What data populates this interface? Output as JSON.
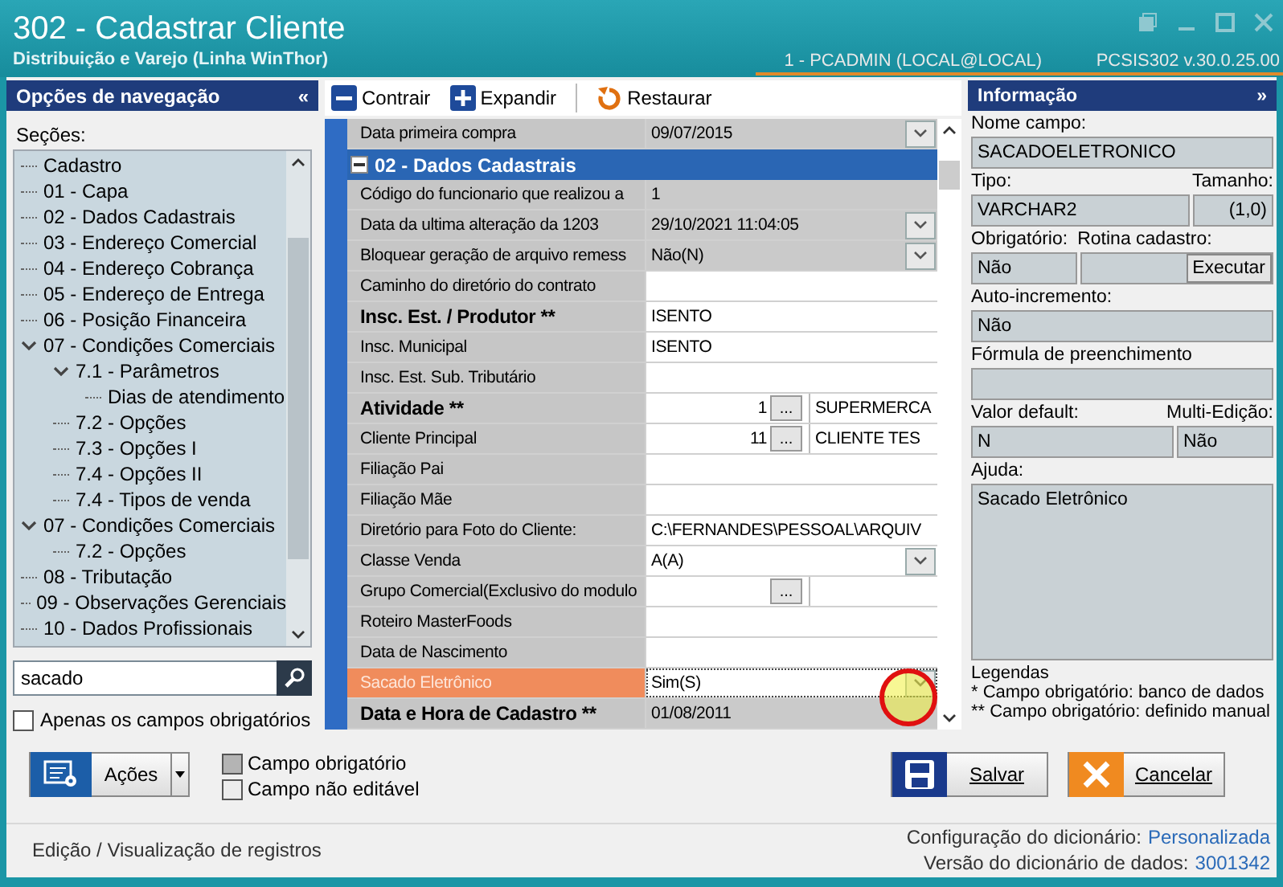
{
  "window": {
    "title": "302 - Cadastrar Cliente",
    "subtitle": "Distribuição e Varejo (Linha WinThor)",
    "user": "1 - PCADMIN (LOCAL@LOCAL)",
    "version": "PCSIS302  v.30.0.25.00"
  },
  "navigation": {
    "title": "Opções de navegação",
    "collapse": "«",
    "sections_label": "Seções:",
    "tree": [
      {
        "label": "Cadastro"
      },
      {
        "label": "01 - Capa"
      },
      {
        "label": "02 - Dados Cadastrais"
      },
      {
        "label": "03 - Endereço Comercial"
      },
      {
        "label": "04 - Endereço Cobrança"
      },
      {
        "label": "05 - Endereço de Entrega"
      },
      {
        "label": "06 - Posição Financeira"
      },
      {
        "label": "07 - Condições Comerciais",
        "expanded": true,
        "children": [
          {
            "label": "7.1 - Parâmetros",
            "expanded": true,
            "children": [
              {
                "label": "Dias de atendimento"
              }
            ]
          },
          {
            "label": "7.2 - Opções"
          },
          {
            "label": "7.3 - Opções I"
          },
          {
            "label": "7.4 - Opções II"
          },
          {
            "label": "7.4 - Tipos de venda"
          }
        ]
      },
      {
        "label": "07 - Condições Comerciais",
        "expanded": true,
        "children": [
          {
            "label": "7.2 - Opções"
          }
        ]
      },
      {
        "label": "08 - Tributação"
      },
      {
        "label": "09 - Observações Gerenciais"
      },
      {
        "label": "10 - Dados Profissionais"
      }
    ],
    "search": {
      "value": "sacado"
    },
    "only_required": {
      "label": "Apenas os campos obrigatórios",
      "checked": false
    }
  },
  "toolbar": [
    {
      "kind": "collapse",
      "label": "Contrair"
    },
    {
      "kind": "expand",
      "label": "Expandir"
    },
    {
      "kind": "restore",
      "label": "Restaurar"
    }
  ],
  "grid": {
    "rows": [
      {
        "kind": "dropdown",
        "label": "Data primeira compra",
        "bold": false,
        "value": "09/07/2015",
        "editable": false,
        "selected": false
      },
      {
        "kind": "section",
        "label": "02 - Dados Cadastrais",
        "expanded": true
      },
      {
        "kind": "text",
        "label": "Código do funcionario que realizou a",
        "bold": false,
        "value": "1",
        "editable": false,
        "selected": false
      },
      {
        "kind": "dropdown",
        "label": "Data da ultima alteração da 1203",
        "bold": false,
        "value": "29/10/2021 11:04:05",
        "editable": false,
        "selected": false
      },
      {
        "kind": "dropdown",
        "label": "Bloquear geração de arquivo remess",
        "bold": false,
        "value": "Não(N)",
        "editable": false,
        "selected": false
      },
      {
        "kind": "text",
        "label": "Caminho do diretório do contrato",
        "bold": false,
        "editable": true,
        "selected": false
      },
      {
        "kind": "text",
        "label": "Insc. Est. / Produtor **",
        "bold": true,
        "value": "ISENTO",
        "editable": true,
        "selected": false
      },
      {
        "kind": "text",
        "label": "Insc. Municipal",
        "bold": false,
        "value": "ISENTO",
        "editable": true,
        "selected": false
      },
      {
        "kind": "text",
        "label": "Insc. Est. Sub. Tributário",
        "bold": false,
        "editable": true,
        "selected": false
      },
      {
        "kind": "lookup",
        "label": "Atividade **",
        "bold": true,
        "code": "1",
        "button": "...",
        "description": "SUPERMERCA",
        "editable": true,
        "selected": false
      },
      {
        "kind": "lookup",
        "label": "Cliente Principal",
        "bold": false,
        "code": "11",
        "button": "...",
        "description": "CLIENTE TES",
        "editable": true,
        "selected": false
      },
      {
        "kind": "text",
        "label": "Filiação Pai",
        "bold": false,
        "editable": true,
        "selected": false
      },
      {
        "kind": "text",
        "label": "Filiação Mãe",
        "bold": false,
        "editable": true,
        "selected": false
      },
      {
        "kind": "text",
        "label": "Diretório para Foto do Cliente:",
        "bold": false,
        "value": "C:\\FERNANDES\\PESSOAL\\ARQUIV",
        "editable": true,
        "selected": false
      },
      {
        "kind": "dropdown",
        "label": "Classe Venda",
        "bold": false,
        "value": "A(A)",
        "editable": true,
        "selected": false
      },
      {
        "kind": "lookup",
        "label": "Grupo Comercial(Exclusivo do modulo",
        "bold": false,
        "button": "...",
        "editable": true,
        "selected": false
      },
      {
        "kind": "text",
        "label": "Roteiro MasterFoods",
        "bold": false,
        "editable": true,
        "selected": false
      },
      {
        "kind": "text",
        "label": "Data de Nascimento",
        "bold": false,
        "editable": true,
        "selected": false
      },
      {
        "kind": "dropdown",
        "label": "Sacado Eletrônico",
        "bold": false,
        "value": "Sim(S)",
        "editable": true,
        "selected": true
      },
      {
        "kind": "text",
        "label": "Data e Hora de Cadastro **",
        "bold": true,
        "value": "01/08/2011",
        "editable": false,
        "selected": false
      }
    ]
  },
  "info": {
    "title": "Informação",
    "collapse": "»",
    "name": {
      "label": "Nome campo:",
      "value": "SACADOELETRONICO"
    },
    "type": {
      "label": "Tipo:",
      "value": "VARCHAR2"
    },
    "size": {
      "label": "Tamanho:",
      "value": "(1,0)"
    },
    "required": {
      "label": "Obrigatório:",
      "value": "Não"
    },
    "routine": {
      "label": "Rotina cadastro:",
      "button": "Executar"
    },
    "auto": {
      "label": "Auto-incremento:",
      "value": "Não"
    },
    "formula": {
      "label": "Fórmula de preenchimento"
    },
    "default": {
      "label": "Valor default:",
      "value": "N"
    },
    "multi": {
      "label": "Multi-Edição:",
      "value": "Não"
    },
    "help": {
      "label": "Ajuda:",
      "value": "Sacado Eletrônico"
    },
    "legend": {
      "title": "Legendas",
      "lines": [
        "* Campo obrigatório: banco de dados",
        "** Campo obrigatório: definido manual"
      ]
    }
  },
  "footer": {
    "actions": "Ações",
    "legend": [
      {
        "kind": "required",
        "label": "Campo obrigatório"
      },
      {
        "kind": "readonly",
        "label": "Campo não editável"
      }
    ],
    "save": "Salvar",
    "cancel": "Cancelar"
  },
  "status": {
    "left": "Edição / Visualização de registros",
    "config_label": "Configuração do dicionário:",
    "config_value": "Personalizada",
    "version_label": "Versão do dicionário de dados:",
    "version_value": "3001342"
  }
}
